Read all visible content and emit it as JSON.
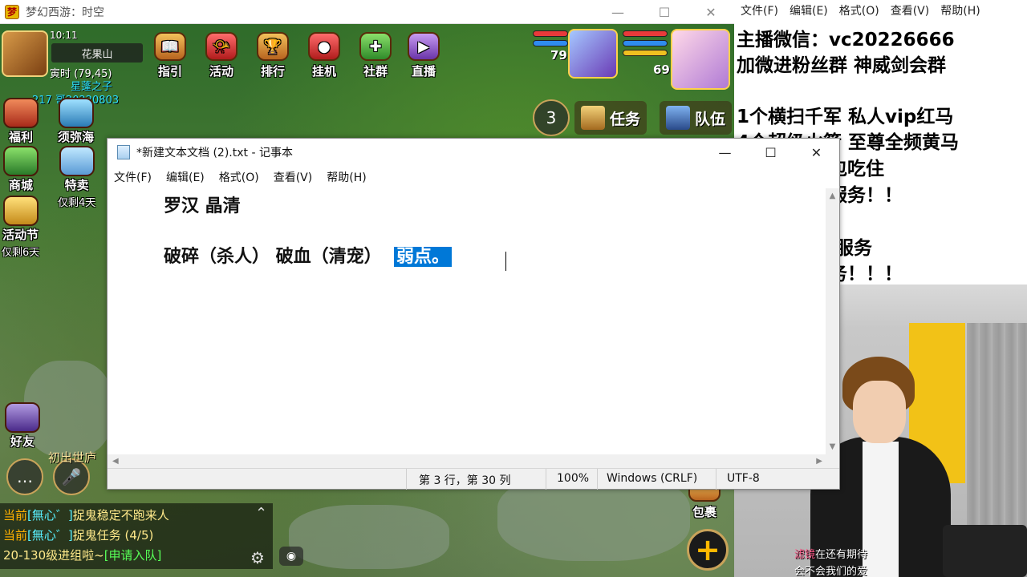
{
  "game": {
    "window_title": "梦幻西游：时空",
    "window_controls": {
      "minimize": "—",
      "maximize": "☐",
      "close": "✕"
    },
    "time": "10:11",
    "location": "花果山",
    "coords": "寅时 (79,45)",
    "player_name": "星蓬之子",
    "player_id": "217   哥20220803",
    "top_buttons": [
      "指引",
      "活动",
      "排行",
      "挂机",
      "社群",
      "直播"
    ],
    "left_buttons": [
      {
        "label": "福利",
        "sub": ""
      },
      {
        "label": "须弥海",
        "sub": ""
      },
      {
        "label": "商城",
        "sub": ""
      },
      {
        "label": "特卖",
        "sub": "仅剩4天"
      },
      {
        "label": "活动节",
        "sub": "仅剩6天"
      },
      {
        "label": "好友",
        "sub": ""
      }
    ],
    "levels": {
      "player": "79",
      "pet": "69"
    },
    "task_label": "任务",
    "team_label": "队伍",
    "bag_label": "包裹",
    "chat": [
      {
        "channel": "当前",
        "name": "[無心゛]",
        "text": "捉鬼稳定不跑来人",
        "action": ""
      },
      {
        "channel": "当前",
        "name": "[無心゛]",
        "text": "捉鬼任务 (4/5)",
        "action": ""
      },
      {
        "channel": "",
        "name": "",
        "text": "20-130级进组啦~",
        "action": "[申请入队]"
      }
    ],
    "world_label": "初出世庐",
    "colors": {
      "hp": "#e83a3a",
      "mp": "#2f8cf0",
      "exp": "#f0c020"
    }
  },
  "ad_pane": {
    "menu": [
      "文件(F)",
      "编辑(E)",
      "格式(O)",
      "查看(V)",
      "帮助(H)"
    ],
    "lines": [
      "主播微信：vc20226666",
      "加微进粉丝群   神威剑会群",
      "",
      " 1个横扫千军  私人vip红马",
      " 4个超级火箭   至尊全频黄马",
      "        路月费守护包吃住",
      "        护尊享各种服务！！",
      "",
      "        推号 一条龙服务",
      "        官服一切业务！！！"
    ]
  },
  "webcam": {
    "danmu": [
      {
        "hl": "滤镜",
        "text": "在还有期待"
      },
      {
        "hl": "",
        "text": "会不会我们的爱"
      }
    ]
  },
  "notepad": {
    "title": "*新建文本文档 (2).txt - 记事本",
    "controls": {
      "minimize": "—",
      "maximize": "☐",
      "close": "✕"
    },
    "menu": [
      "文件(F)",
      "编辑(E)",
      "格式(O)",
      "查看(V)",
      "帮助(H)"
    ],
    "line1": "罗汉 晶清",
    "line3_plain": "破碎（杀人） 破血（清宠）  ",
    "line3_selected": "弱点。",
    "status": {
      "position": "第 3 行，第 30 列",
      "zoom": "100%",
      "line_ending": "Windows (CRLF)",
      "encoding": "UTF-8"
    }
  }
}
